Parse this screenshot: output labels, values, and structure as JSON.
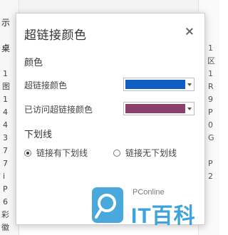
{
  "background": {
    "fragments": [
      "示",
      "桌",
      "1",
      "图",
      "1",
      "4",
      "4",
      "3",
      "7",
      "7",
      "i",
      "P",
      "6",
      "彩",
      "徽",
      "1",
      "区",
      "1",
      "R",
      "9",
      "P",
      "0",
      "G",
      "P",
      "2"
    ]
  },
  "dialog": {
    "title": "超链接颜色",
    "section_color": "颜色",
    "hyperlink_label": "超链接颜色",
    "hyperlink_color": "#0f5fc3",
    "visited_label": "已访问超链接颜色",
    "visited_color": "#8a3f6c",
    "section_underline": "下划线",
    "radio_with": "链接有下划线",
    "radio_without": "链接无下划线",
    "selected": "radio_with"
  },
  "watermark": {
    "brand": "PConline",
    "name": "IT百科",
    "color": "#2a9ad6"
  }
}
